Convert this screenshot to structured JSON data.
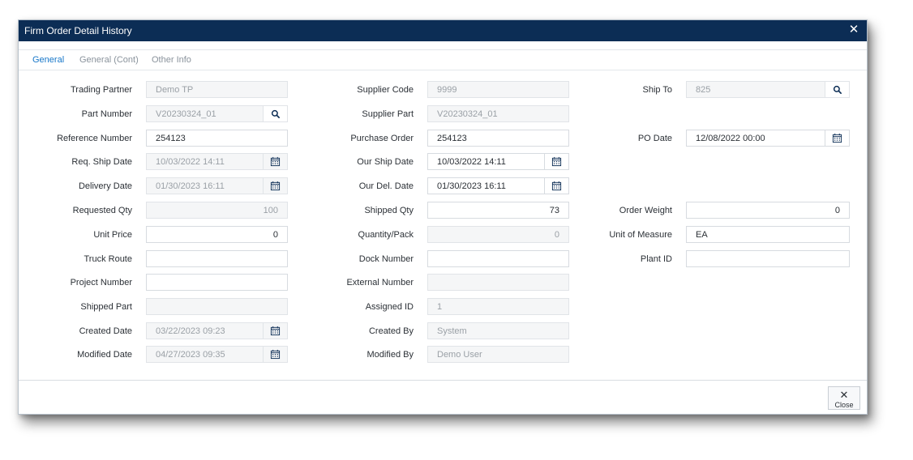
{
  "dialog": {
    "title": "Firm Order Detail History"
  },
  "tabs": [
    {
      "label": "General",
      "active": true
    },
    {
      "label": "General (Cont)",
      "active": false
    },
    {
      "label": "Other Info",
      "active": false
    }
  ],
  "fields": {
    "trading_partner": {
      "label": "Trading Partner",
      "value": "Demo TP"
    },
    "part_number": {
      "label": "Part Number",
      "value": "V20230324_01"
    },
    "reference_number": {
      "label": "Reference Number",
      "value": "254123"
    },
    "req_ship_date": {
      "label": "Req. Ship Date",
      "value": "10/03/2022 14:11"
    },
    "delivery_date": {
      "label": "Delivery Date",
      "value": "01/30/2023 16:11"
    },
    "requested_qty": {
      "label": "Requested Qty",
      "value": "100"
    },
    "unit_price": {
      "label": "Unit Price",
      "value": "0"
    },
    "truck_route": {
      "label": "Truck Route",
      "value": ""
    },
    "project_number": {
      "label": "Project Number",
      "value": ""
    },
    "shipped_part": {
      "label": "Shipped Part",
      "value": ""
    },
    "created_date": {
      "label": "Created Date",
      "value": "03/22/2023 09:23"
    },
    "modified_date": {
      "label": "Modified Date",
      "value": "04/27/2023 09:35"
    },
    "supplier_code": {
      "label": "Supplier Code",
      "value": "9999"
    },
    "supplier_part": {
      "label": "Supplier Part",
      "value": "V20230324_01"
    },
    "purchase_order": {
      "label": "Purchase Order",
      "value": "254123"
    },
    "our_ship_date": {
      "label": "Our Ship Date",
      "value": "10/03/2022 14:11"
    },
    "our_del_date": {
      "label": "Our Del. Date",
      "value": "01/30/2023 16:11"
    },
    "shipped_qty": {
      "label": "Shipped Qty",
      "value": "73"
    },
    "quantity_pack": {
      "label": "Quantity/Pack",
      "value": "0"
    },
    "dock_number": {
      "label": "Dock Number",
      "value": ""
    },
    "external_number": {
      "label": "External Number",
      "value": ""
    },
    "assigned_id": {
      "label": "Assigned ID",
      "value": "1"
    },
    "created_by": {
      "label": "Created By",
      "value": "System"
    },
    "modified_by": {
      "label": "Modified By",
      "value": "Demo User"
    },
    "ship_to": {
      "label": "Ship To",
      "value": "825"
    },
    "po_date": {
      "label": "PO Date",
      "value": "12/08/2022 00:00"
    },
    "order_weight": {
      "label": "Order Weight",
      "value": "0"
    },
    "unit_of_measure": {
      "label": "Unit of Measure",
      "value": "EA"
    },
    "plant_id": {
      "label": "Plant ID",
      "value": ""
    }
  },
  "footer": {
    "close_label": "Close"
  },
  "icons": {
    "search": "search-icon",
    "calendar": "calendar-icon",
    "close": "close-icon"
  },
  "colors": {
    "titlebar": "#0c2d55",
    "active_tab": "#1777c9",
    "readonly_bg": "#f5f6f7"
  }
}
